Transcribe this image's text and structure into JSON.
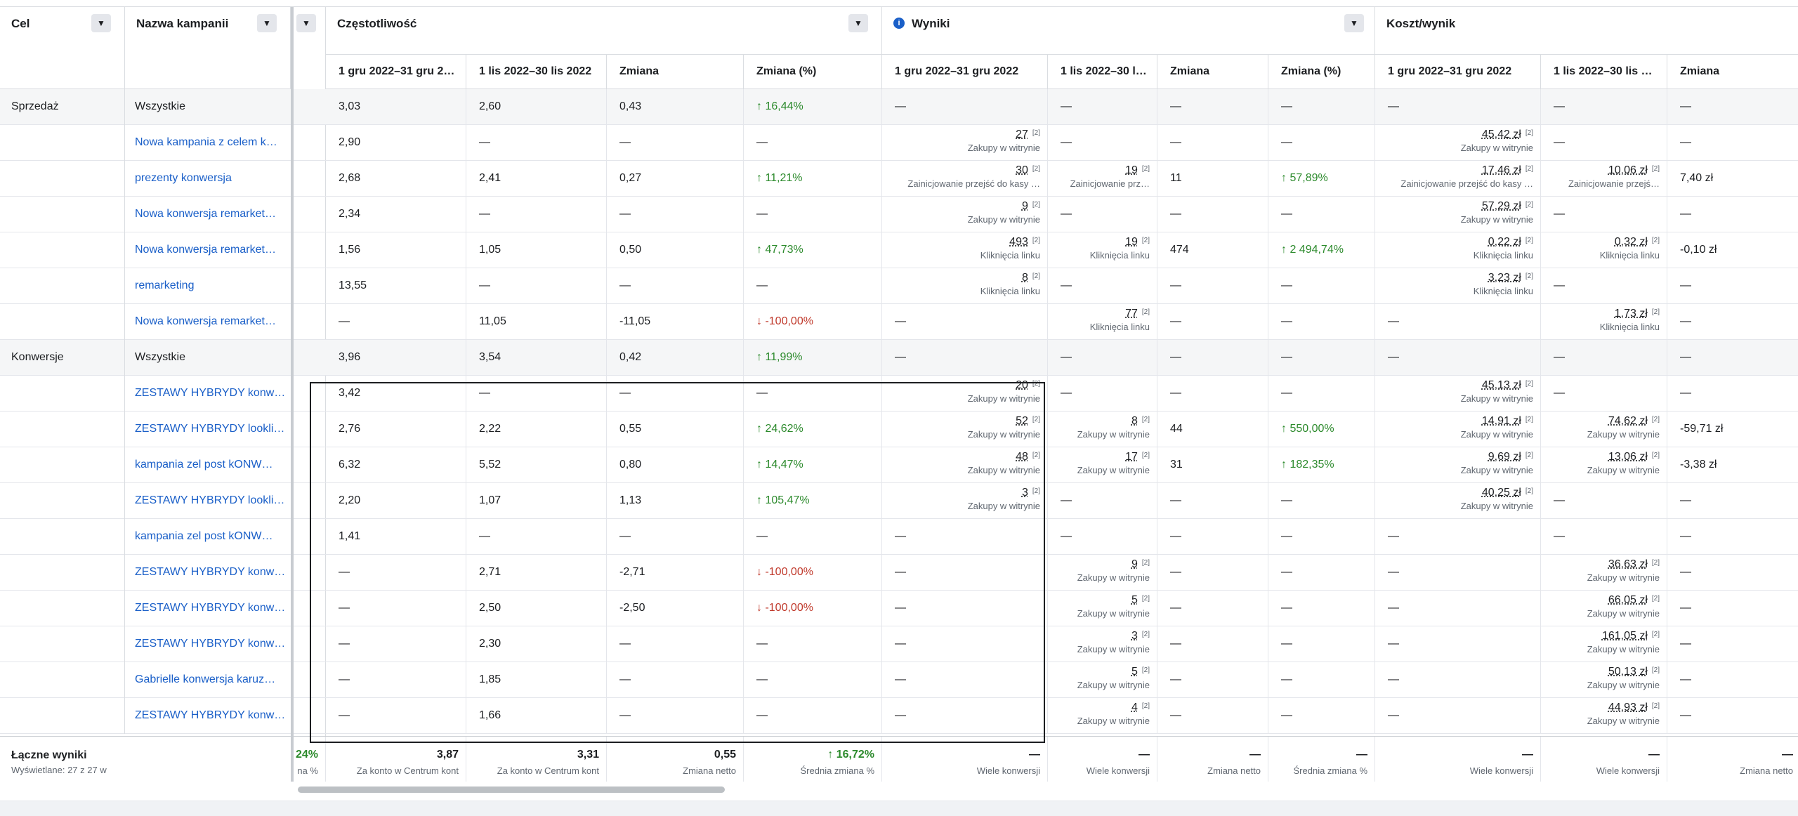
{
  "headers": {
    "cel": "Cel",
    "kampania": "Nazwa kampanii",
    "czestotliwosc": "Częstotliwość",
    "wyniki": "Wyniki",
    "koszt": "Koszt/wynik",
    "info_icon": "i",
    "sub": [
      "1 gru 2022–31 gru 2…",
      "1 lis 2022–30 lis 2022",
      "Zmiana",
      "Zmiana (%)",
      "1 gru 2022–31 gru 2022",
      "1 lis 2022–30 l…",
      "Zmiana",
      "Zmiana (%)",
      "1 gru 2022–31 gru 2022",
      "1 lis 2022–30 lis …",
      "Zmiana"
    ]
  },
  "rows": [
    {
      "group": true,
      "cel": "Sprzedaż",
      "name": "Wszystkie",
      "link": false,
      "f1": "3,03",
      "f2": "2,60",
      "fz": "0,43",
      "fp": "↑ 16,44%",
      "fpc": "up",
      "w1": "—",
      "w1s": "",
      "w2": "—",
      "w2s": "",
      "wz": "—",
      "wp": "—",
      "wpc": "",
      "k1": "—",
      "k1s": "",
      "k2": "—",
      "k2s": "",
      "kz": "—"
    },
    {
      "cel": "",
      "name": "Nowa kampania z celem k…",
      "link": true,
      "f1": "2,90",
      "f2": "—",
      "fz": "—",
      "fp": "—",
      "fpc": "",
      "w1": "27",
      "w1s": "Zakupy w witrynie",
      "w2": "—",
      "w2s": "",
      "wz": "—",
      "wp": "—",
      "wpc": "",
      "k1": "45,42 zł",
      "k1s": "Zakupy w witrynie",
      "k2": "—",
      "k2s": "",
      "kz": "—"
    },
    {
      "cel": "",
      "name": "prezenty konwersja",
      "link": true,
      "f1": "2,68",
      "f2": "2,41",
      "fz": "0,27",
      "fp": "↑ 11,21%",
      "fpc": "up",
      "w1": "30",
      "w1s": "Zainicjowanie przejść do kasy …",
      "w2": "19",
      "w2s": "Zainicjowanie prz…",
      "wz": "11",
      "wp": "↑ 57,89%",
      "wpc": "up",
      "k1": "17,46 zł",
      "k1s": "Zainicjowanie przejść do kasy …",
      "k2": "10,06 zł",
      "k2s": "Zainicjowanie przejś…",
      "kz": "7,40 zł"
    },
    {
      "cel": "",
      "name": "Nowa konwersja remarket…",
      "link": true,
      "f1": "2,34",
      "f2": "—",
      "fz": "—",
      "fp": "—",
      "fpc": "",
      "w1": "9",
      "w1s": "Zakupy w witrynie",
      "w2": "—",
      "w2s": "",
      "wz": "—",
      "wp": "—",
      "wpc": "",
      "k1": "57,29 zł",
      "k1s": "Zakupy w witrynie",
      "k2": "—",
      "k2s": "",
      "kz": "—"
    },
    {
      "cel": "",
      "name": "Nowa konwersja remarket…",
      "link": true,
      "f1": "1,56",
      "f2": "1,05",
      "fz": "0,50",
      "fp": "↑ 47,73%",
      "fpc": "up",
      "w1": "493",
      "w1s": "Kliknięcia linku",
      "w2": "19",
      "w2s": "Kliknięcia linku",
      "wz": "474",
      "wp": "↑ 2 494,74%",
      "wpc": "up",
      "k1": "0,22 zł",
      "k1s": "Kliknięcia linku",
      "k2": "0,32 zł",
      "k2s": "Kliknięcia linku",
      "kz": "-0,10 zł"
    },
    {
      "cel": "",
      "name": "remarketing",
      "link": true,
      "f1": "13,55",
      "f2": "—",
      "fz": "—",
      "fp": "—",
      "fpc": "",
      "w1": "8",
      "w1s": "Kliknięcia linku",
      "w2": "—",
      "w2s": "",
      "wz": "—",
      "wp": "—",
      "wpc": "",
      "k1": "3,23 zł",
      "k1s": "Kliknięcia linku",
      "k2": "—",
      "k2s": "",
      "kz": "—"
    },
    {
      "cel": "",
      "name": "Nowa konwersja remarket…",
      "link": true,
      "f1": "—",
      "f2": "11,05",
      "fz": "-11,05",
      "fp": "↓ -100,00%",
      "fpc": "down",
      "w1": "—",
      "w1s": "",
      "w2": "77",
      "w2s": "Kliknięcia linku",
      "wz": "—",
      "wp": "—",
      "wpc": "",
      "k1": "—",
      "k1s": "",
      "k2": "1,73 zł",
      "k2s": "Kliknięcia linku",
      "kz": "—"
    },
    {
      "group": true,
      "cel": "Konwersje",
      "name": "Wszystkie",
      "link": false,
      "f1": "3,96",
      "f2": "3,54",
      "fz": "0,42",
      "fp": "↑ 11,99%",
      "fpc": "up",
      "w1": "—",
      "w1s": "",
      "w2": "—",
      "w2s": "",
      "wz": "—",
      "wp": "—",
      "wpc": "",
      "k1": "—",
      "k1s": "",
      "k2": "—",
      "k2s": "",
      "kz": "—"
    },
    {
      "cel": "",
      "name": "ZESTAWY HYBRYDY konw…",
      "link": true,
      "f1": "3,42",
      "f2": "—",
      "fz": "—",
      "fp": "—",
      "fpc": "",
      "w1": "20",
      "w1s": "Zakupy w witrynie",
      "w2": "—",
      "w2s": "",
      "wz": "—",
      "wp": "—",
      "wpc": "",
      "k1": "45,13 zł",
      "k1s": "Zakupy w witrynie",
      "k2": "—",
      "k2s": "",
      "kz": "—"
    },
    {
      "cel": "",
      "name": "ZESTAWY HYBRYDY lookli…",
      "link": true,
      "f1": "2,76",
      "f2": "2,22",
      "fz": "0,55",
      "fp": "↑ 24,62%",
      "fpc": "up",
      "w1": "52",
      "w1s": "Zakupy w witrynie",
      "w2": "8",
      "w2s": "Zakupy w witrynie",
      "wz": "44",
      "wp": "↑ 550,00%",
      "wpc": "up",
      "k1": "14,91 zł",
      "k1s": "Zakupy w witrynie",
      "k2": "74,62 zł",
      "k2s": "Zakupy w witrynie",
      "kz": "-59,71 zł"
    },
    {
      "cel": "",
      "name": "kampania zel post kONW…",
      "link": true,
      "f1": "6,32",
      "f2": "5,52",
      "fz": "0,80",
      "fp": "↑ 14,47%",
      "fpc": "up",
      "w1": "48",
      "w1s": "Zakupy w witrynie",
      "w2": "17",
      "w2s": "Zakupy w witrynie",
      "wz": "31",
      "wp": "↑ 182,35%",
      "wpc": "up",
      "k1": "9,69 zł",
      "k1s": "Zakupy w witrynie",
      "k2": "13,06 zł",
      "k2s": "Zakupy w witrynie",
      "kz": "-3,38 zł"
    },
    {
      "cel": "",
      "name": "ZESTAWY HYBRYDY lookli…",
      "link": true,
      "f1": "2,20",
      "f2": "1,07",
      "fz": "1,13",
      "fp": "↑ 105,47%",
      "fpc": "up",
      "w1": "3",
      "w1s": "Zakupy w witrynie",
      "w2": "—",
      "w2s": "",
      "wz": "—",
      "wp": "—",
      "wpc": "",
      "k1": "40,25 zł",
      "k1s": "Zakupy w witrynie",
      "k2": "—",
      "k2s": "",
      "kz": "—"
    },
    {
      "cel": "",
      "name": "kampania zel post kONW…",
      "link": true,
      "f1": "1,41",
      "f2": "—",
      "fz": "—",
      "fp": "—",
      "fpc": "",
      "w1": "—",
      "w1s": "",
      "w2": "—",
      "w2s": "",
      "wz": "—",
      "wp": "—",
      "wpc": "",
      "k1": "—",
      "k1s": "",
      "k2": "—",
      "k2s": "",
      "kz": "—"
    },
    {
      "cel": "",
      "name": "ZESTAWY HYBRYDY konw…",
      "link": true,
      "f1": "—",
      "f2": "2,71",
      "fz": "-2,71",
      "fp": "↓ -100,00%",
      "fpc": "down",
      "w1": "—",
      "w1s": "",
      "w2": "9",
      "w2s": "Zakupy w witrynie",
      "wz": "—",
      "wp": "—",
      "wpc": "",
      "k1": "—",
      "k1s": "",
      "k2": "36,63 zł",
      "k2s": "Zakupy w witrynie",
      "kz": "—"
    },
    {
      "cel": "",
      "name": "ZESTAWY HYBRYDY konw…",
      "link": true,
      "f1": "—",
      "f2": "2,50",
      "fz": "-2,50",
      "fp": "↓ -100,00%",
      "fpc": "down",
      "w1": "—",
      "w1s": "",
      "w2": "5",
      "w2s": "Zakupy w witrynie",
      "wz": "—",
      "wp": "—",
      "wpc": "",
      "k1": "—",
      "k1s": "",
      "k2": "66,05 zł",
      "k2s": "Zakupy w witrynie",
      "kz": "—"
    },
    {
      "cel": "",
      "name": "ZESTAWY HYBRYDY konw…",
      "link": true,
      "f1": "—",
      "f2": "2,30",
      "fz": "—",
      "fp": "—",
      "fpc": "",
      "w1": "—",
      "w1s": "",
      "w2": "3",
      "w2s": "Zakupy w witrynie",
      "wz": "—",
      "wp": "—",
      "wpc": "",
      "k1": "—",
      "k1s": "",
      "k2": "161,05 zł",
      "k2s": "Zakupy w witrynie",
      "kz": "—"
    },
    {
      "cel": "",
      "name": "Gabrielle konwersja karuz…",
      "link": true,
      "f1": "—",
      "f2": "1,85",
      "fz": "—",
      "fp": "—",
      "fpc": "",
      "w1": "—",
      "w1s": "",
      "w2": "5",
      "w2s": "Zakupy w witrynie",
      "wz": "—",
      "wp": "—",
      "wpc": "",
      "k1": "—",
      "k1s": "",
      "k2": "50,13 zł",
      "k2s": "Zakupy w witrynie",
      "kz": "—"
    },
    {
      "cel": "",
      "name": "ZESTAWY HYBRYDY konw…",
      "link": true,
      "f1": "—",
      "f2": "1,66",
      "fz": "—",
      "fp": "—",
      "fpc": "",
      "w1": "—",
      "w1s": "",
      "w2": "4",
      "w2s": "Zakupy w witrynie",
      "wz": "—",
      "wp": "—",
      "wpc": "",
      "k1": "—",
      "k1s": "",
      "k2": "44,93 zł",
      "k2s": "Zakupy w witrynie",
      "kz": "—"
    }
  ],
  "totals": {
    "title": "Łączne wyniki",
    "subtitle": "Wyświetlane: 27 z 27 w",
    "stub_value": "24%",
    "stub_label": "na %",
    "cells": [
      {
        "v": "3,87",
        "l": "Za konto w Centrum kont"
      },
      {
        "v": "3,31",
        "l": "Za konto w Centrum kont"
      },
      {
        "v": "0,55",
        "l": "Zmiana netto"
      },
      {
        "v": "↑ 16,72%",
        "l": "Średnia zmiana %",
        "c": "up"
      },
      {
        "v": "—",
        "l": "Wiele konwersji"
      },
      {
        "v": "—",
        "l": "Wiele konwersji"
      },
      {
        "v": "—",
        "l": "Zmiana netto"
      },
      {
        "v": "—",
        "l": "Średnia zmiana %"
      },
      {
        "v": "—",
        "l": "Wiele konwersji"
      },
      {
        "v": "—",
        "l": "Wiele konwersji"
      },
      {
        "v": "—",
        "l": "Zmiana netto"
      }
    ]
  },
  "colors": {
    "link": "#1a5fc8",
    "up": "#2c8a2c",
    "down": "#c0392b"
  }
}
